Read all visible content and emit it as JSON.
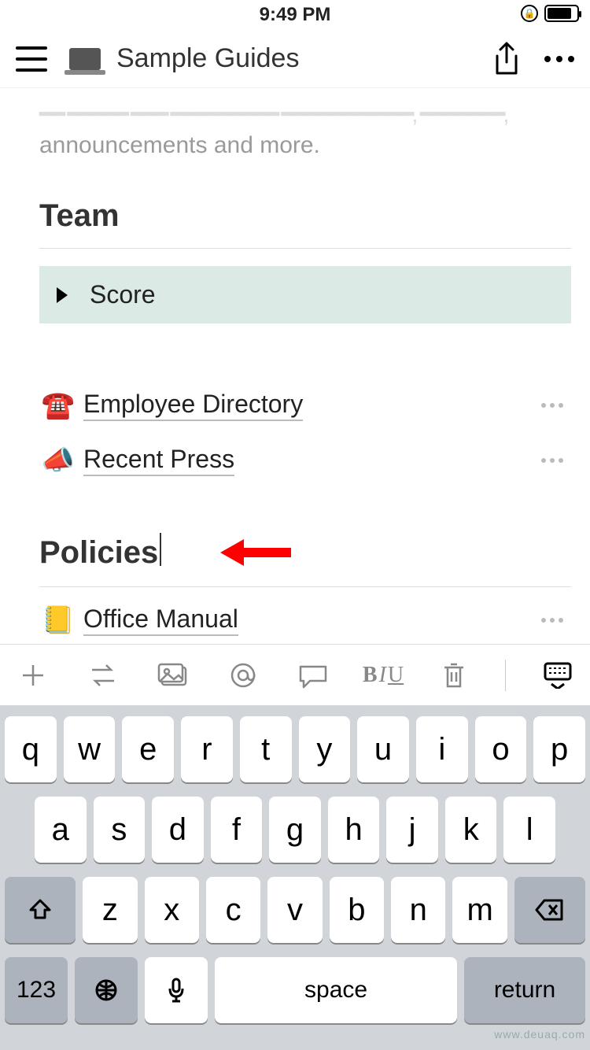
{
  "status": {
    "time": "9:49 PM"
  },
  "header": {
    "title": "Sample Guides",
    "icon": "laptop-icon"
  },
  "content": {
    "intro_tail": "announcements and more.",
    "section_team": "Team",
    "toggle_score": "Score",
    "pages": {
      "employee_dir": {
        "emoji": "☎️",
        "label": "Employee Directory"
      },
      "recent_press": {
        "emoji": "📣",
        "label": "Recent Press"
      },
      "office_manual": {
        "emoji": "📒",
        "label": "Office Manual"
      }
    },
    "section_policies": "Policies"
  },
  "keyboard": {
    "row1": [
      "q",
      "w",
      "e",
      "r",
      "t",
      "y",
      "u",
      "i",
      "o",
      "p"
    ],
    "row2": [
      "a",
      "s",
      "d",
      "f",
      "g",
      "h",
      "j",
      "k",
      "l"
    ],
    "row3": [
      "z",
      "x",
      "c",
      "v",
      "b",
      "n",
      "m"
    ],
    "numKey": "123",
    "space": "space",
    "return": "return"
  },
  "watermark": "www.deuaq.com"
}
